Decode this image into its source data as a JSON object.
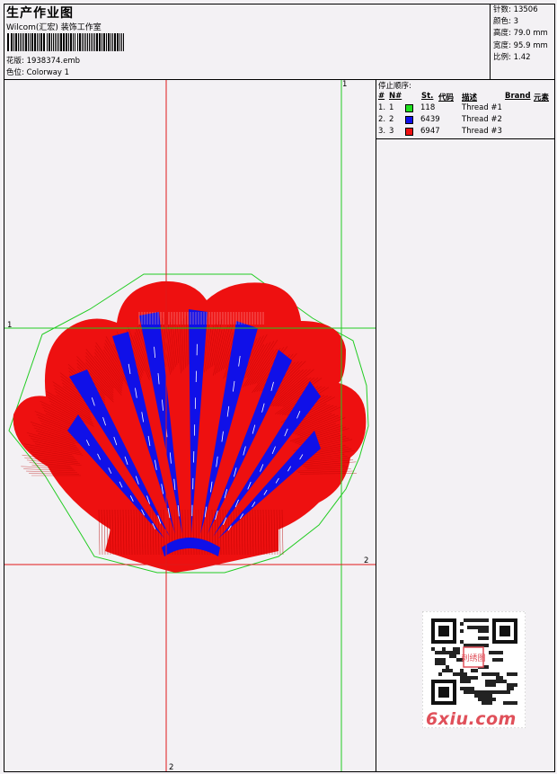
{
  "header": {
    "title": "生产作业图",
    "company": "Wilcom(汇宏) 装饰工作室",
    "design_label": "花版:",
    "design_value": "1938374.emb",
    "colorway_label": "色位:",
    "colorway_value": "Colorway 1"
  },
  "stats": {
    "stitches_label": "针数:",
    "stitches_value": "13506",
    "colors_label": "颜色:",
    "colors_value": "3",
    "height_label": "高度:",
    "height_value": "79.0 mm",
    "width_label": "宽度:",
    "width_value": "95.9 mm",
    "scale_label": "比例:",
    "scale_value": "1.42"
  },
  "stop_sequence": {
    "title": "停止顺序:",
    "columns": {
      "num": "#",
      "n": "N#",
      "st": "St.",
      "code": "代码",
      "desc": "描述",
      "brand": "Brand",
      "element": "元素"
    },
    "rows": [
      {
        "num": "1.",
        "n": "1",
        "code": "118",
        "color": "#1ee01e",
        "desc": "Thread #1"
      },
      {
        "num": "2.",
        "n": "2",
        "code": "6439",
        "color": "#1010e8",
        "desc": "Thread #2"
      },
      {
        "num": "3.",
        "n": "3",
        "code": "6947",
        "color": "#ee1010",
        "desc": "Thread #3"
      }
    ]
  },
  "guides": {
    "vertical_green_label": "1",
    "horizontal_green_label": "1",
    "horizontal_red_label": "2",
    "vertical_red_label": "2"
  },
  "colors": {
    "green": "#1ee01e",
    "blue": "#1010e8",
    "red": "#ee1010",
    "guide_red": "#e01818",
    "guide_green": "#22cc22"
  },
  "watermark": "6xiu.com",
  "qr_badge": "刺绣图"
}
